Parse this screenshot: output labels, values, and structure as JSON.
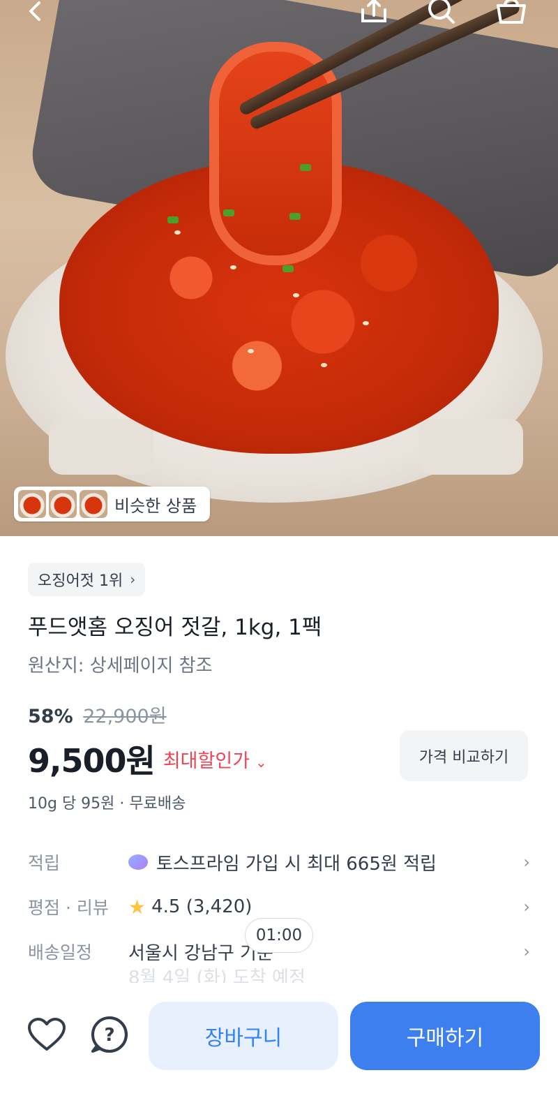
{
  "header": {
    "icons": [
      "back-icon",
      "share-icon",
      "search-icon",
      "basket-icon"
    ]
  },
  "hero": {
    "similar_products_label": "비슷한 상품",
    "thumbnail_count": 3
  },
  "product": {
    "rank_badge": "오징어젓 1위",
    "title": "푸드앳홈 오징어 젓갈, 1kg, 1팩",
    "origin": "원산지: 상세페이지 참조",
    "discount_rate": "58%",
    "original_price": "22,900원",
    "price": "9,500원",
    "max_discount_label": "최대할인가",
    "compare_button": "가격 비교하기",
    "unit_info": "10g 당 95원 · 무료배송"
  },
  "info_rows": {
    "points": {
      "key": "적립",
      "value": "토스프라임 가입 시 최대 665원 적립"
    },
    "rating": {
      "key": "평점 · 리뷰",
      "value": "4.5 (3,420)"
    },
    "delivery": {
      "key": "배송일정",
      "value": "서울시 강남구 기준",
      "faded_value": "8월 4일 (화) 도착 예정"
    }
  },
  "timer": {
    "value": "01:00"
  },
  "bottom_bar": {
    "cart_button": "장바구니",
    "buy_button": "구매하기"
  },
  "colors": {
    "primary": "#3e7ff0",
    "primary_light": "#e8f0fd",
    "discount_red": "#f04452",
    "star": "#ffc342"
  }
}
